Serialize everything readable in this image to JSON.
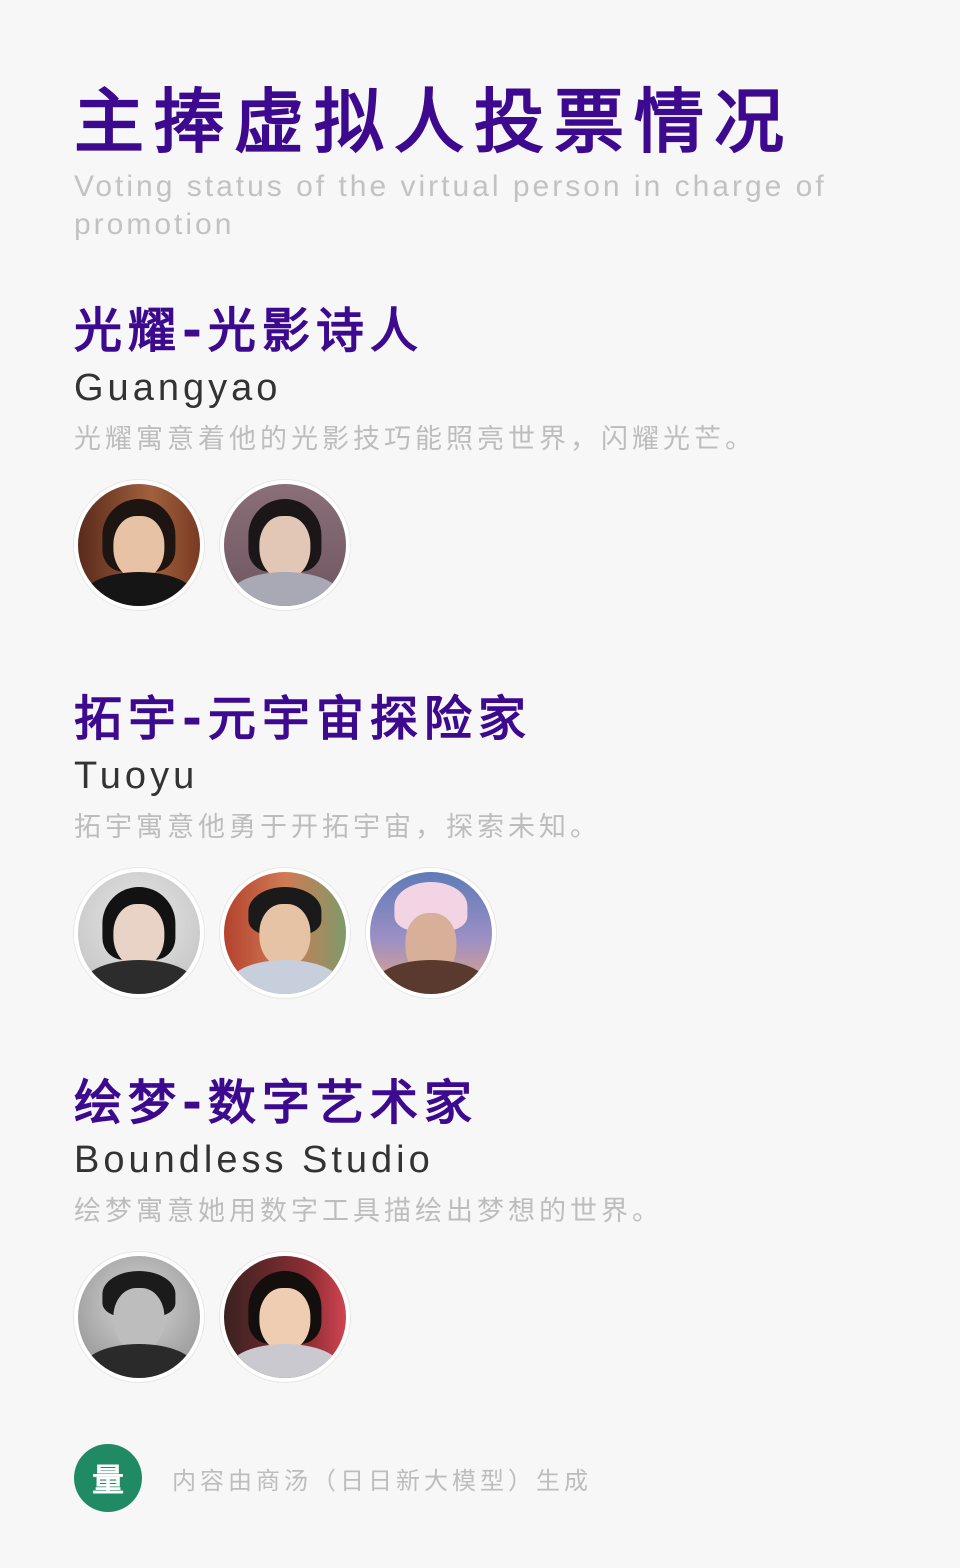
{
  "page": {
    "title": "主捧虚拟人投票情况",
    "subtitle": "Voting status of the virtual person in charge of promotion"
  },
  "sections": [
    {
      "cn_name": "光耀-光影诗人",
      "en_name": "Guangyao",
      "desc": "光耀寓意着他的光影技巧能照亮世界，闪耀光芒。",
      "avatars": [
        {
          "icon": "avatar-woman-dark-hair"
        },
        {
          "icon": "avatar-woman-blouse"
        }
      ]
    },
    {
      "cn_name": "拓宇-元宇宙探险家",
      "en_name": "Tuoyu",
      "desc": "拓宇寓意他勇于开拓宇宙，探索未知。",
      "avatars": [
        {
          "icon": "avatar-woman-bob-hair"
        },
        {
          "icon": "avatar-man-suit"
        },
        {
          "icon": "avatar-woman-beanie"
        }
      ]
    },
    {
      "cn_name": "绘梦-数字艺术家",
      "en_name": "Boundless Studio",
      "desc": "绘梦寓意她用数字工具描绘出梦想的世界。",
      "avatars": [
        {
          "icon": "avatar-man-monochrome"
        },
        {
          "icon": "avatar-woman-smiling"
        }
      ]
    }
  ],
  "footer": {
    "logo_glyph": "量",
    "text": "内容由商汤（日日新大模型）生成"
  },
  "colors": {
    "title": "#3d0a8f",
    "footer_logo": "#1f8a63"
  }
}
